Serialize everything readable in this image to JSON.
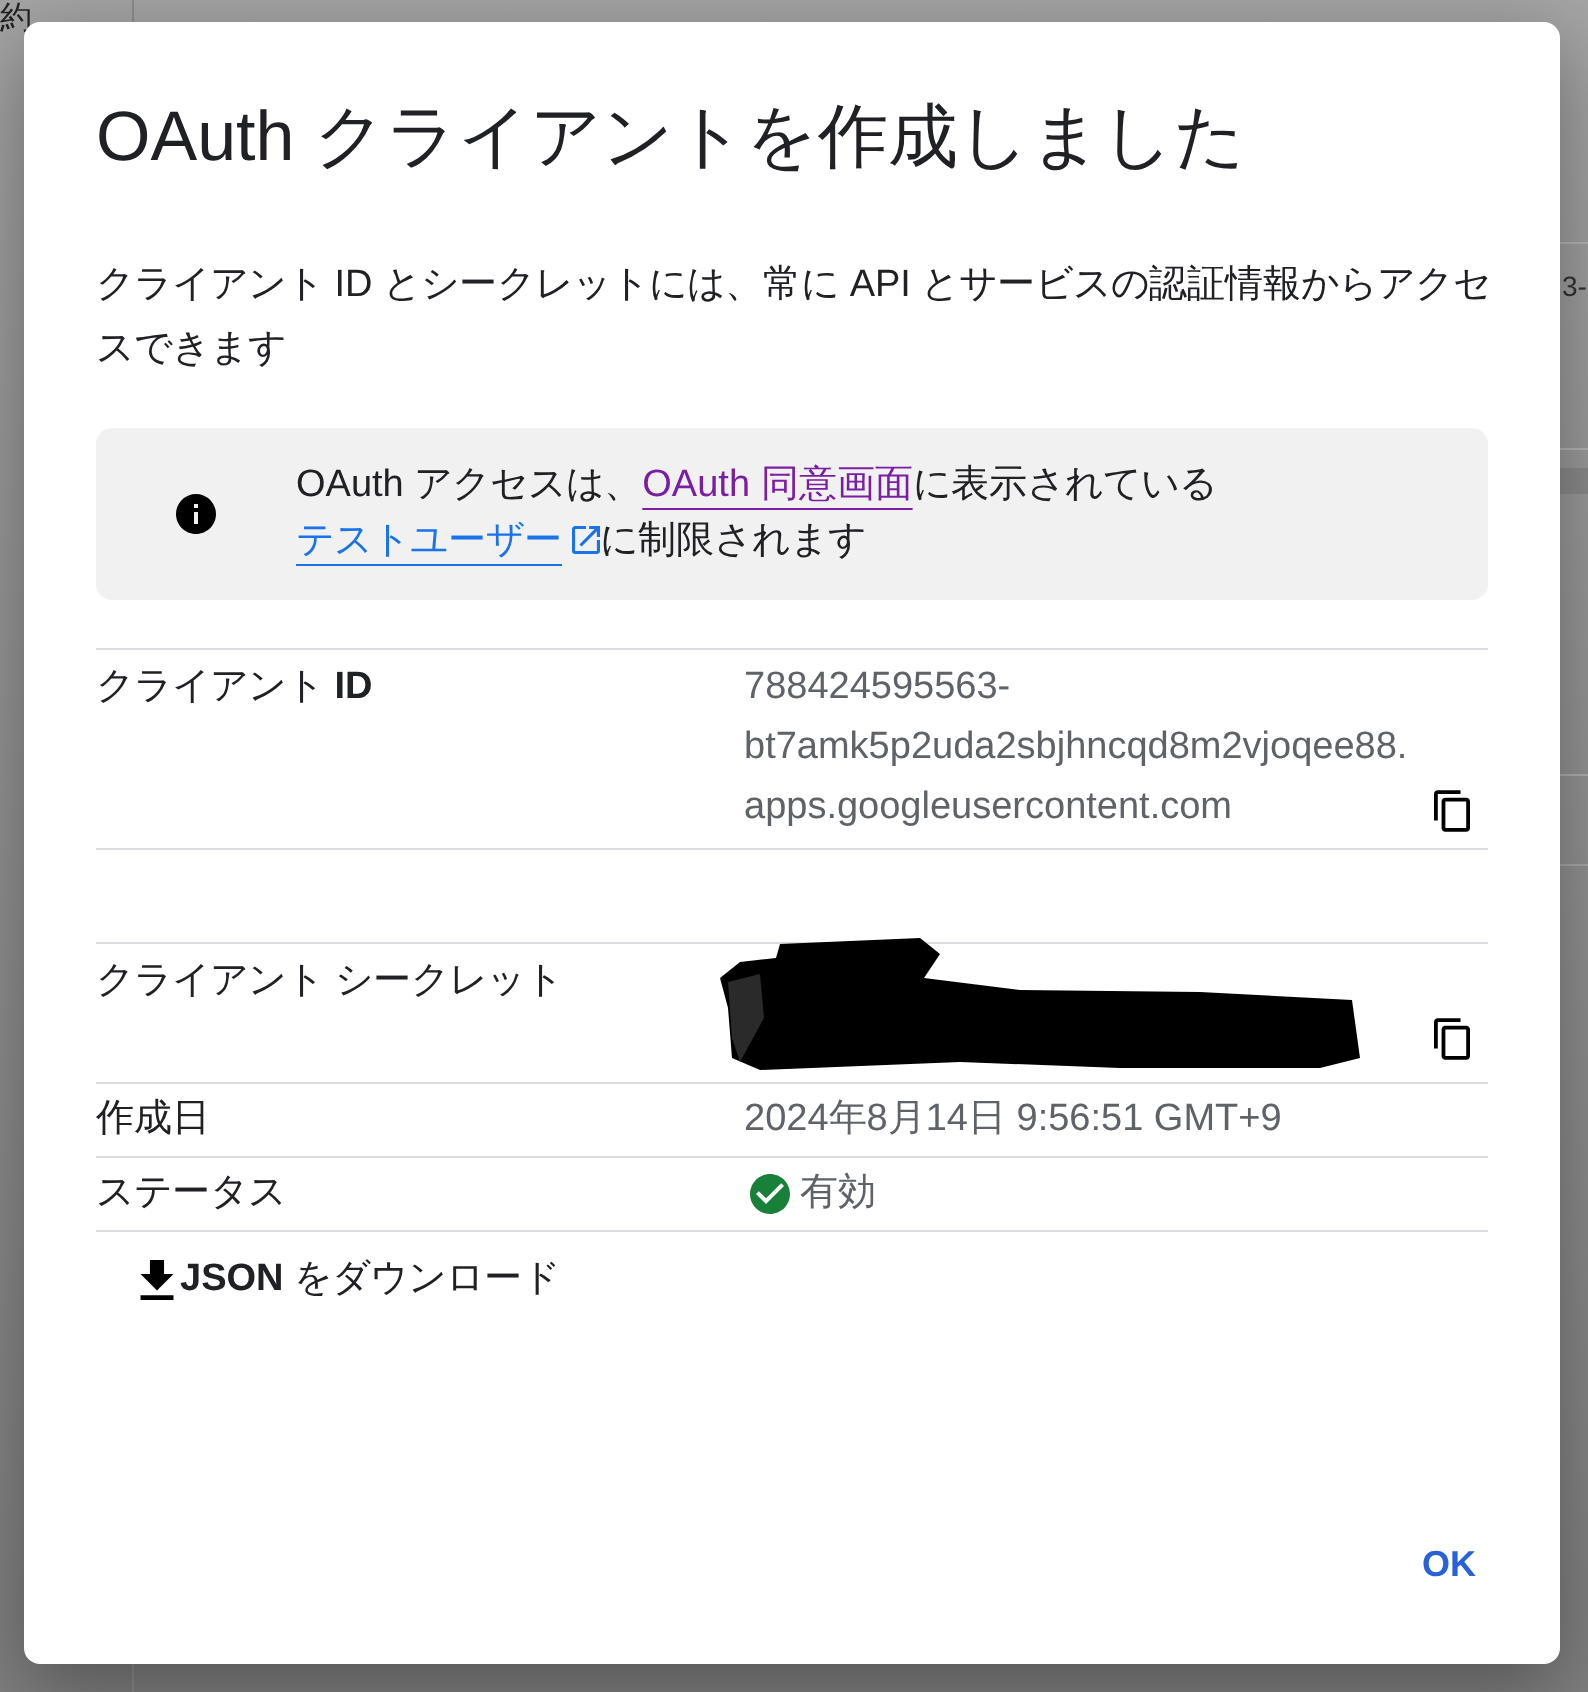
{
  "background": {
    "texts": [
      {
        "text": "約"
      },
      {
        "text": "3-"
      }
    ]
  },
  "dialog": {
    "title": "OAuth クライアントを作成しました",
    "description": "クライアント ID とシークレットには、常に API とサービスの認証情報からアクセスできます",
    "notice": {
      "segments": [
        {
          "kind": "text",
          "text": "OAuth アクセスは、"
        },
        {
          "kind": "link",
          "text": "OAuth 同意画面",
          "visited": true,
          "external": false
        },
        {
          "kind": "text",
          "text": "に表示されている"
        },
        {
          "kind": "link",
          "text": "テストユーザー",
          "visited": false,
          "external": true
        },
        {
          "kind": "text",
          "text": "に制限されます"
        }
      ]
    },
    "detail_sections": [
      {
        "rows": [
          {
            "kind": "copy",
            "label": "クライアント **ID**",
            "value": "788424595563-bt7amk5p2uda2sbjhncqd8m2vjoqee88.apps.googleusercontent.com"
          }
        ]
      },
      {
        "rows": [
          {
            "kind": "secret",
            "label": "クライアント シークレット"
          },
          {
            "kind": "text",
            "label": "作成日",
            "value": "2024年8月14日 9:56:51 GMT+9"
          },
          {
            "kind": "status",
            "label": "ステータス",
            "value": "有効",
            "active": true
          }
        ]
      }
    ],
    "download_button": "**JSON** をダウンロード",
    "ok_button": "OK"
  }
}
